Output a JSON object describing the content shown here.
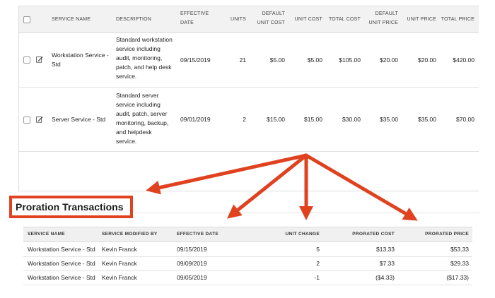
{
  "services_table": {
    "headers": {
      "service_name": "SERVICE NAME",
      "description": "DESCRIPTION",
      "effective_date": [
        "EFFECTIVE",
        "DATE"
      ],
      "units": "UNITS",
      "default_unit_cost": [
        "DEFAULT",
        "UNIT COST"
      ],
      "unit_cost": "UNIT COST",
      "total_cost": "TOTAL COST",
      "default_unit_price": [
        "DEFAULT",
        "UNIT PRICE"
      ],
      "unit_price": "UNIT PRICE",
      "total_price": "TOTAL PRICE"
    },
    "rows": [
      {
        "service_name": [
          "Workstation Service -",
          "Std"
        ],
        "description": [
          "Standard workstation",
          "service including",
          "audit, monitoring,",
          "patch, and help desk",
          "service."
        ],
        "effective_date": "09/15/2019",
        "units": "21",
        "default_unit_cost": "$5.00",
        "unit_cost": "$5.00",
        "total_cost": "$105.00",
        "default_unit_price": "$20.00",
        "unit_price": "$20.00",
        "total_price": "$420.00"
      },
      {
        "service_name": [
          "Server Service - Std"
        ],
        "description": [
          "Standard server",
          "service including",
          "audit, patch, server",
          "monitoring, backup,",
          "and helpdesk",
          "service."
        ],
        "effective_date": "09/01/2019",
        "units": "2",
        "default_unit_cost": "$15.00",
        "unit_cost": "$15.00",
        "total_cost": "$30.00",
        "default_unit_price": "$35.00",
        "unit_price": "$35.00",
        "total_price": "$70.00"
      }
    ]
  },
  "proration": {
    "title": "Proration Transactions",
    "headers": {
      "service_name": "SERVICE NAME",
      "modified_by": "SERVICE MODIFIED BY",
      "effective_date": "EFFECTIVE DATE",
      "unit_change": "UNIT CHANGE",
      "prorated_cost": "PRORATED COST",
      "prorated_price": "PRORATED PRICE"
    },
    "rows": [
      {
        "service_name": "Workstation Service - Std",
        "modified_by": "Kevin Franck",
        "effective_date": "09/15/2019",
        "unit_change": "5",
        "prorated_cost": "$13.33",
        "prorated_price": "$53.33"
      },
      {
        "service_name": "Workstation Service - Std",
        "modified_by": "Kevin Franck",
        "effective_date": "09/09/2019",
        "unit_change": "2",
        "prorated_cost": "$7.33",
        "prorated_price": "$29.33"
      },
      {
        "service_name": "Workstation Service - Std",
        "modified_by": "Kevin Franck",
        "effective_date": "09/05/2019",
        "unit_change": "-1",
        "prorated_cost": "($4.33)",
        "prorated_price": "($17.33)"
      }
    ]
  },
  "colors": {
    "annotation": "#e0421f",
    "header_bg": "#f2f2f2"
  }
}
